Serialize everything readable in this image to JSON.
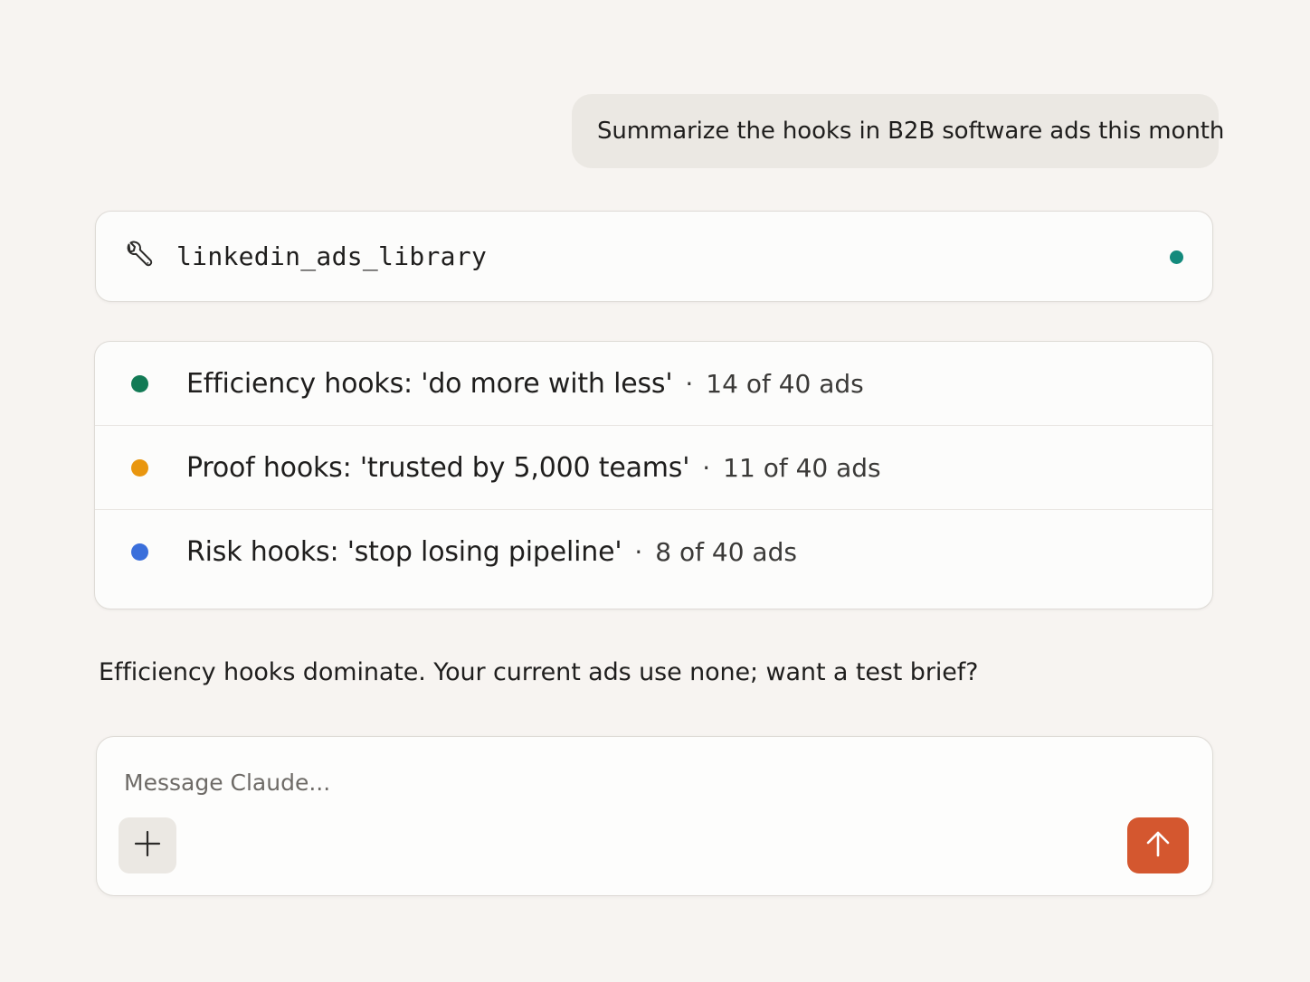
{
  "conversation": {
    "user_message": "Summarize the hooks in B2B software ads this month",
    "tool_call": {
      "icon": "wrench-icon",
      "name": "linkedin_ads_library",
      "status_color": "#138a7c"
    },
    "results": [
      {
        "label": "Efficiency hooks: 'do more with less'",
        "separator": "·",
        "count": "14 of 40 ads",
        "color": "#127a55"
      },
      {
        "label": "Proof hooks: 'trusted by 5,000 teams'",
        "separator": "·",
        "count": "11 of 40 ads",
        "color": "#e9960e"
      },
      {
        "label": "Risk hooks: 'stop losing pipeline'",
        "separator": "·",
        "count": "8 of 40 ads",
        "color": "#3a6fdb"
      }
    ],
    "assistant_message": "Efficiency hooks dominate. Your current ads use none; want a test brief?"
  },
  "composer": {
    "placeholder": "Message Claude...",
    "value": "",
    "add_icon": "plus-icon",
    "send_icon": "arrow-up-icon",
    "send_color": "#d4572f"
  }
}
